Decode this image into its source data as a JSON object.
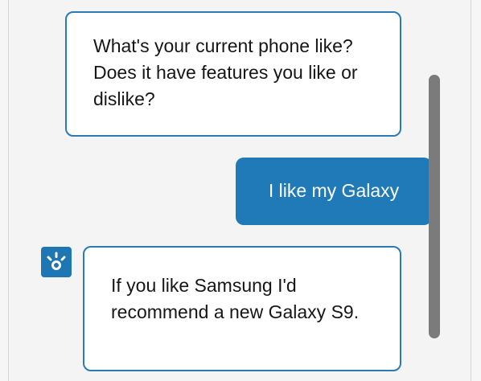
{
  "messages": [
    {
      "sender": "bot",
      "text": "What's your current phone like? Does it have features you like or dislike?"
    },
    {
      "sender": "user",
      "text": "I like my Galaxy"
    },
    {
      "sender": "bot",
      "text": "If you like Samsung I'd recommend a new Galaxy S9."
    }
  ],
  "avatar": {
    "icon": "bot-logo-icon"
  },
  "colors": {
    "accent": "#1f7ab7",
    "bot_bubble_border": "#2a7ab8",
    "bot_bubble_bg": "#ffffff",
    "panel_bg": "#f4f4f4",
    "scrollbar": "#7b7b7b"
  }
}
